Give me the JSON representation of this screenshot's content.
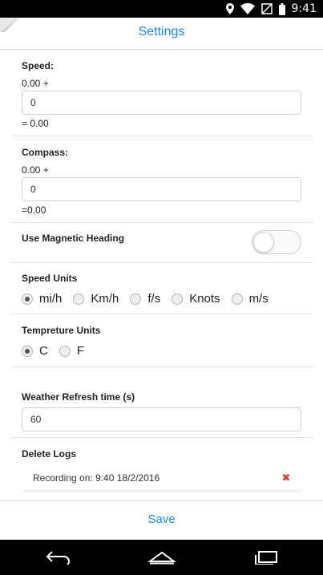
{
  "status_bar": {
    "time": "9:41",
    "icons": [
      "location-icon",
      "wifi-icon",
      "mute-icon",
      "battery-icon"
    ]
  },
  "header": {
    "title": "Settings"
  },
  "speed": {
    "label": "Speed:",
    "prefix": "0.00 +",
    "value": "0",
    "result": "= 0.00"
  },
  "compass": {
    "label": "Compass:",
    "prefix": "0.00 +",
    "value": "0",
    "result": "=0.00"
  },
  "magnetic": {
    "label": "Use Magnetic Heading",
    "enabled": false
  },
  "speed_units": {
    "label": "Speed Units",
    "options": [
      "mi/h",
      "Km/h",
      "f/s",
      "Knots",
      "m/s"
    ],
    "selected": "mi/h"
  },
  "temperature_units": {
    "label": "Tempreture Units",
    "options": [
      "C",
      "F"
    ],
    "selected": "C"
  },
  "weather": {
    "label": "Weather Refresh time (s)",
    "value": "60"
  },
  "logs": {
    "label": "Delete Logs",
    "items": [
      {
        "text": "Recording on: 9:40 18/2/2016"
      }
    ]
  },
  "footer": {
    "save_label": "Save"
  },
  "colors": {
    "accent": "#1e88e5",
    "delete": "#e53935"
  }
}
